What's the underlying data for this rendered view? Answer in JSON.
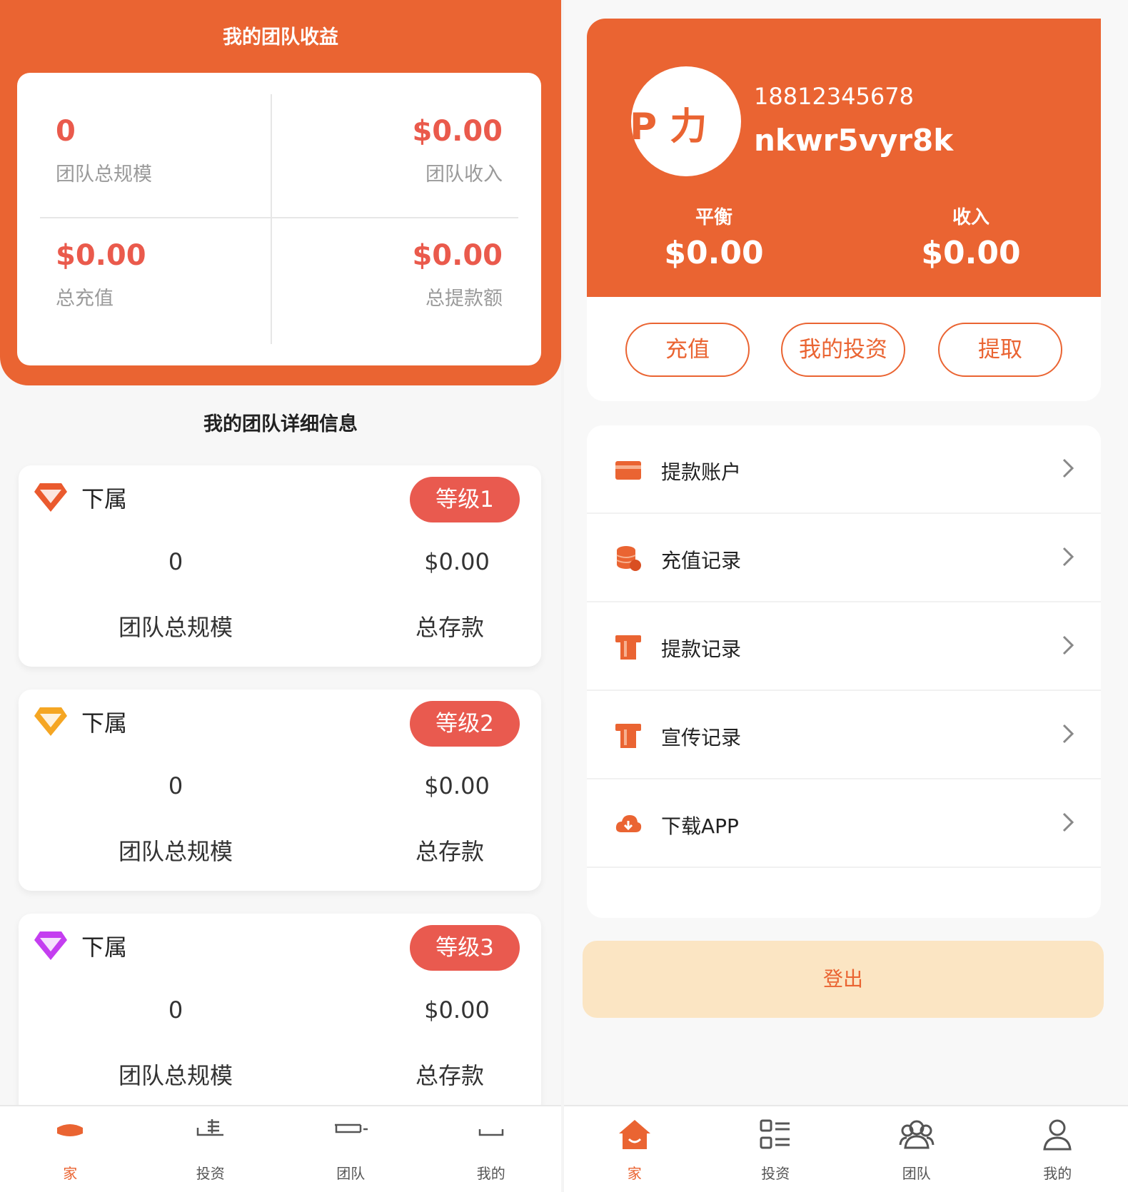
{
  "left": {
    "header_title": "我的团队收益",
    "stats": [
      {
        "value": "0",
        "label": "团队总规模"
      },
      {
        "value": "$0.00",
        "label": "团队收入"
      },
      {
        "value": "$0.00",
        "label": "总充值"
      },
      {
        "value": "$0.00",
        "label": "总提款额"
      }
    ],
    "section_title": "我的团队详细信息",
    "levels": [
      {
        "title": "下属",
        "badge": "等级1",
        "count": "0",
        "amount": "$0.00",
        "count_label": "团队总规模",
        "amount_label": "总存款",
        "gem_color": "#ea5a2e"
      },
      {
        "title": "下属",
        "badge": "等级2",
        "count": "0",
        "amount": "$0.00",
        "count_label": "团队总规模",
        "amount_label": "总存款",
        "gem_color": "#f5a623"
      },
      {
        "title": "下属",
        "badge": "等级3",
        "count": "0",
        "amount": "$0.00",
        "count_label": "团队总规模",
        "amount_label": "总存款",
        "gem_color": "#c43ef0"
      }
    ],
    "tabs": [
      {
        "label": "家",
        "icon": "home-icon"
      },
      {
        "label": "投资",
        "icon": "invest-icon"
      },
      {
        "label": "团队",
        "icon": "team-icon"
      },
      {
        "label": "我的",
        "icon": "profile-icon"
      }
    ]
  },
  "right": {
    "avatar_text": "P 力",
    "phone": "18812345678",
    "username": "nkwr5vyr8k",
    "balance_label": "平衡",
    "balance_value": "$0.00",
    "income_label": "收入",
    "income_value": "$0.00",
    "buttons": [
      "充值",
      "我的投资",
      "提取"
    ],
    "menu": [
      {
        "label": "提款账户",
        "icon": "card-icon"
      },
      {
        "label": "充值记录",
        "icon": "coins-icon"
      },
      {
        "label": "提款记录",
        "icon": "receipt-icon"
      },
      {
        "label": "宣传记录",
        "icon": "receipt-icon"
      },
      {
        "label": "下载APP",
        "icon": "cloud-download-icon"
      }
    ],
    "logout": "登出",
    "tabs": [
      {
        "label": "家",
        "icon": "home-icon"
      },
      {
        "label": "投资",
        "icon": "invest-icon"
      },
      {
        "label": "团队",
        "icon": "team-icon"
      },
      {
        "label": "我的",
        "icon": "profile-icon"
      }
    ]
  },
  "colors": {
    "accent": "#ea6432",
    "value_red": "#ea5a4c",
    "badge_red": "#e95a4f",
    "logout_bg": "#fbe5c3"
  }
}
